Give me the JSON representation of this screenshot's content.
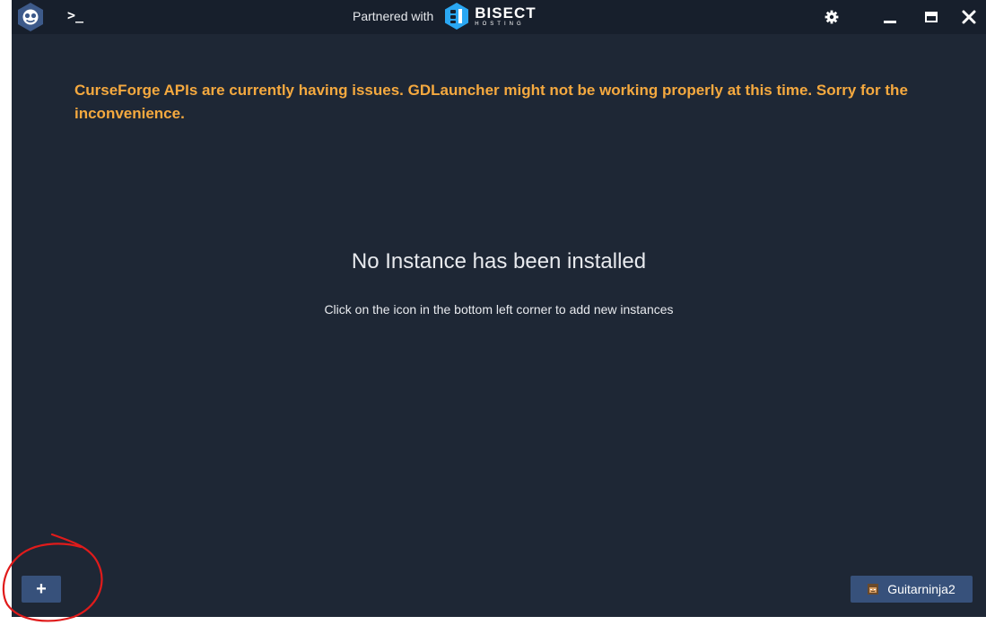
{
  "titlebar": {
    "terminal_label": ">_",
    "partner_text": "Partnered with",
    "partner_brand": "BISECT",
    "partner_sub": "HOSTING",
    "icons": {
      "logo": "gdlauncher-logo-icon",
      "terminal": "terminal-icon",
      "settings": "gear-icon",
      "minimize": "minimize-icon",
      "maximize": "maximize-icon",
      "close": "close-icon"
    }
  },
  "main": {
    "warning": "CurseForge APIs are currently having issues. GDLauncher might not be working properly at this time. Sorry for the inconvenience.",
    "empty_title": "No Instance has been installed",
    "empty_subtitle": "Click on the icon in the bottom left corner to add new instances"
  },
  "footer": {
    "add_label": "+",
    "account_name": "Guitarninja2"
  },
  "colors": {
    "window_bg": "#1e2735",
    "titlebar_bg": "#171f2c",
    "warning": "#f5a93f",
    "button_bg": "#37517b",
    "bisect_blue": "#2aa7f2",
    "annotation_red": "#e01b1b"
  }
}
